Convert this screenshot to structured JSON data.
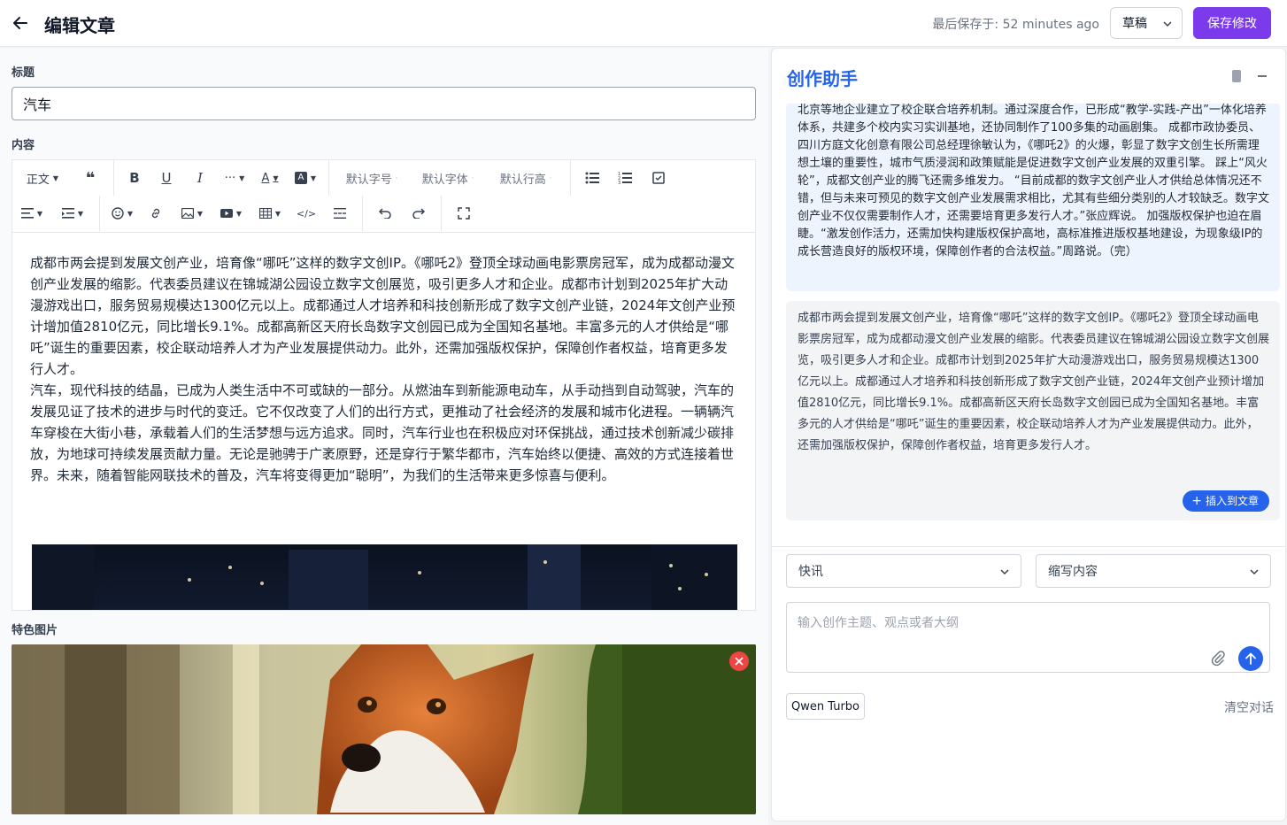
{
  "header": {
    "title": "编辑文章",
    "last_saved": "最后保存于: 52 minutes ago",
    "status_select": "草稿",
    "save_label": "保存修改"
  },
  "form": {
    "title_label": "标题",
    "title_value": "汽车",
    "content_label": "内容",
    "featured_label": "特色图片"
  },
  "toolbar": {
    "paragraph": "正文",
    "font_size": "默认字号",
    "font_family": "默认字体",
    "line_height": "默认行高"
  },
  "content": {
    "paragraph1": "成都市两会提到发展文创产业，培育像“哪吒”这样的数字文创IP。《哪吒2》登顶全球动画电影票房冠军，成为成都动漫文创产业发展的缩影。代表委员建议在锦城湖公园设立数字文创展览，吸引更多人才和企业。成都市计划到2025年扩大动漫游戏出口，服务贸易规模达1300亿元以上。成都通过人才培养和科技创新形成了数字文创产业链，2024年文创产业预计增加值2810亿元，同比增长9.1%。成都高新区天府长岛数字文创园已成为全国知名基地。丰富多元的人才供给是“哪吒”诞生的重要因素，校企联动培养人才为产业发展提供动力。此外，还需加强版权保护，保障创作者权益，培育更多发行人才。",
    "paragraph2": "汽车，现代科技的结晶，已成为人类生活中不可或缺的一部分。从燃油车到新能源电动车，从手动挡到自动驾驶，汽车的发展见证了技术的进步与时代的变迁。它不仅改变了人们的出行方式，更推动了社会经济的发展和城市化进程。一辆辆汽车穿梭在大街小巷，承载着人们的生活梦想与远方追求。同时，汽车行业也在积极应对环保挑战，通过技术创新减少碳排放，为地球可持续发展贡献力量。无论是驰骋于广袤原野，还是穿行于繁华都市，汽车始终以便捷、高效的方式连接着世界。未来，随着智能网联技术的普及，汽车将变得更加“聪明”，为我们的生活带来更多惊喜与便利。"
  },
  "assistant": {
    "title": "创作助手",
    "msg1": "北京等地企业建立了校企联合培养机制。通过深度合作，已形成“教学-实践-产出”一体化培养体系，共建多个校内实习实训基地，还协同制作了100多集的动画剧集。 成都市政协委员、四川方庭文化创意有限公司总经理徐敏认为，《哪吒2》的火爆，彰显了数字文创生长所需理想土壤的重要性，城市气质浸润和政策赋能是促进数字文创产业发展的双重引擎。 踩上“风火轮”，成都文创产业的腾飞还需多维发力。 “目前成都的数字文创产业人才供给总体情况还不错，但与未来可预见的数字文创产业发展需求相比，尤其有些细分类别的人才较缺乏。数字文创产业不仅仅需要制作人才，还需要培育更多发行人才。”张应辉说。 加强版权保护也迫在眉睫。“激发创作活力，还需加快构建版权保护高地，高标准推进版权基地建设，为现象级IP的成长营造良好的版权环境，保障创作者的合法权益。”周路说。（完）",
    "msg2": "成都市两会提到发展文创产业，培育像“哪吒”这样的数字文创IP。《哪吒2》登顶全球动画电影票房冠军，成为成都动漫文创产业发展的缩影。代表委员建议在锦城湖公园设立数字文创展览，吸引更多人才和企业。成都市计划到2025年扩大动漫游戏出口，服务贸易规模达1300亿元以上。成都通过人才培养和科技创新形成了数字文创产业链，2024年文创产业预计增加值2810亿元，同比增长9.1%。成都高新区天府长岛数字文创园已成为全国知名基地。丰富多元的人才供给是“哪吒”诞生的重要因素，校企联动培养人才为产业发展提供动力。此外，还需加强版权保护，保障创作者权益，培育更多发行人才。",
    "insert_label": "插入到文章",
    "type_select": "快讯",
    "action_select": "缩写内容",
    "prompt_placeholder": "输入创作主题、观点或者大纲",
    "model": "Qwen Turbo",
    "clear_label": "清空对话"
  },
  "colors": {
    "accent_purple": "#7c3aed",
    "accent_blue": "#2563eb",
    "remove_red": "#ef4444"
  }
}
